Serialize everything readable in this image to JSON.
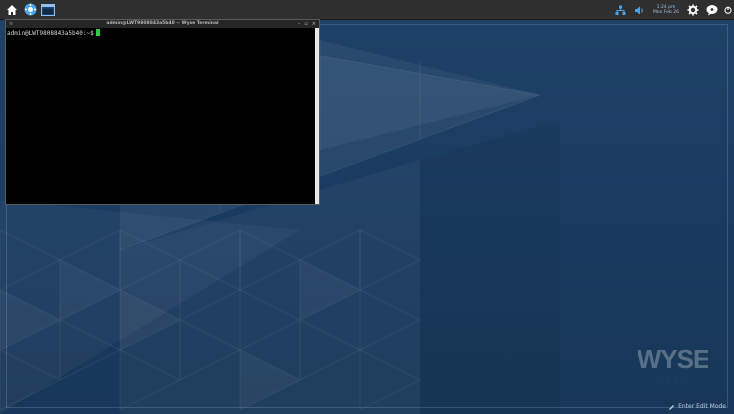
{
  "taskbar": {
    "left_icons": [
      "home-icon",
      "settings-icon",
      "terminal-icon"
    ],
    "clock_time": "1:24 pm",
    "clock_date": "Mon Feb 26",
    "right_icons": [
      "network-icon",
      "volume-icon",
      "gear-icon",
      "chat-icon",
      "power-icon"
    ]
  },
  "terminal": {
    "menu_label": "≡",
    "title": "admin@LWT9808843a5b40 -- Wyse Terminal",
    "controls": {
      "minimize": "–",
      "maximize": "▫",
      "close": "×"
    },
    "prompt": "admin@LWT9808843a5b40:~$"
  },
  "desktop": {
    "logo_text": "WYSE",
    "logo_subtext": "·  ·  ·  ·",
    "edit_mode_label": "Enter Edit Mode"
  },
  "colors": {
    "desktop_bg": "#1c3e63",
    "taskbar_bg": "#2f2f2f",
    "cursor": "#2ecc40",
    "accent": "#4aa3e8"
  }
}
